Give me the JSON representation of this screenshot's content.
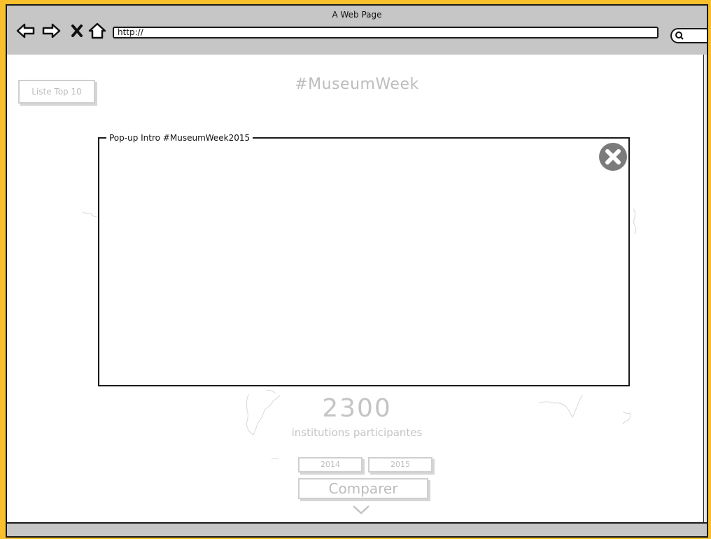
{
  "window": {
    "title": "A Web Page"
  },
  "browser": {
    "url": "http://"
  },
  "nav_icons": [
    "back-arrow-icon",
    "forward-arrow-icon",
    "close-x-icon",
    "home-icon"
  ],
  "page": {
    "title": "#MuseumWeek",
    "liste_button": "Liste Top 10",
    "stat_number": "2300",
    "stat_label": "institutions participantes",
    "year_buttons": [
      "2014",
      "2015"
    ],
    "compare_button": "Comparer"
  },
  "popup": {
    "title": "Pop-up Intro #MuseumWeek2015",
    "close_icon": "close-circle-icon"
  },
  "colors": {
    "frame": "#f7c02c",
    "chrome": "#c6c6c6",
    "muted_text": "#bdbdbd"
  }
}
